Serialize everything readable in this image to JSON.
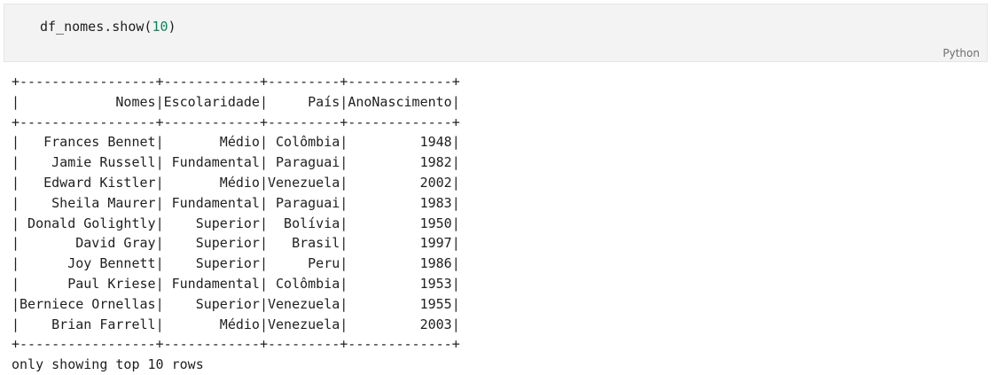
{
  "code_cell": {
    "code_prefix": "df_nomes.show(",
    "code_arg": "10",
    "code_suffix": ")",
    "language_label": "Python"
  },
  "output": {
    "columns": [
      "Nomes",
      "Escolaridade",
      "País",
      "AnoNascimento"
    ],
    "rows": [
      [
        "Frances Bennet",
        "Médio",
        "Colômbia",
        "1948"
      ],
      [
        "Jamie Russell",
        "Fundamental",
        "Paraguai",
        "1982"
      ],
      [
        "Edward Kistler",
        "Médio",
        "Venezuela",
        "2002"
      ],
      [
        "Sheila Maurer",
        "Fundamental",
        "Paraguai",
        "1983"
      ],
      [
        "Donald Golightly",
        "Superior",
        "Bolívia",
        "1950"
      ],
      [
        "David Gray",
        "Superior",
        "Brasil",
        "1997"
      ],
      [
        "Joy Bennett",
        "Superior",
        "Peru",
        "1986"
      ],
      [
        "Paul Kriese",
        "Fundamental",
        "Colômbia",
        "1953"
      ],
      [
        "Berniece Ornellas",
        "Superior",
        "Venezuela",
        "1955"
      ],
      [
        "Brian Farrell",
        "Médio",
        "Venezuela",
        "2003"
      ]
    ],
    "footer": "only showing top 10 rows"
  }
}
